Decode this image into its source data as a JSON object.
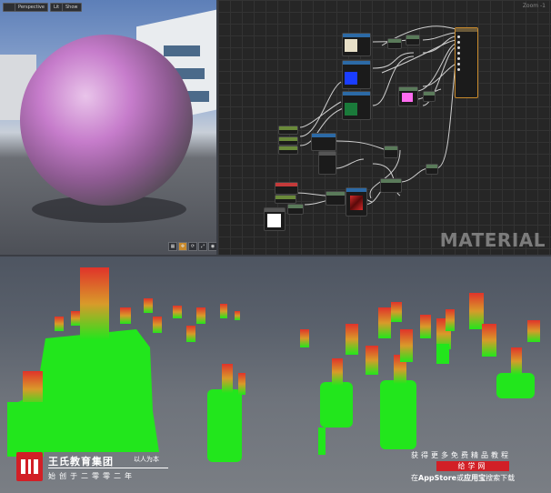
{
  "viewport": {
    "buttons": [
      "",
      "Perspective",
      "Lit",
      "Show"
    ],
    "icons": [
      "grid-icon",
      "move-icon",
      "rotate-icon",
      "scale-icon",
      "camera-icon"
    ]
  },
  "graph": {
    "zoom_label": "Zoom -1",
    "watermark": "MATERIAL",
    "swatch_colors": [
      "#e8e0c8",
      "#1a3dff",
      "#1a7a3a",
      "#ff6cf0",
      "#ffffff",
      "#d42a2a"
    ]
  },
  "watermark": {
    "brand": "王氏教育集团",
    "motto": "以人为本",
    "subtitle": "始创于二零零二年",
    "promo_line1": "获得更多免费精品教程",
    "promo_badge": "给学网",
    "promo_line2_a": "在",
    "promo_line2_b": "AppStore",
    "promo_line2_c": "或",
    "promo_line2_d": "应用宝",
    "promo_line2_e": "搜索下载",
    "logo_letter": "W",
    "brand_color": "#d21f26"
  }
}
